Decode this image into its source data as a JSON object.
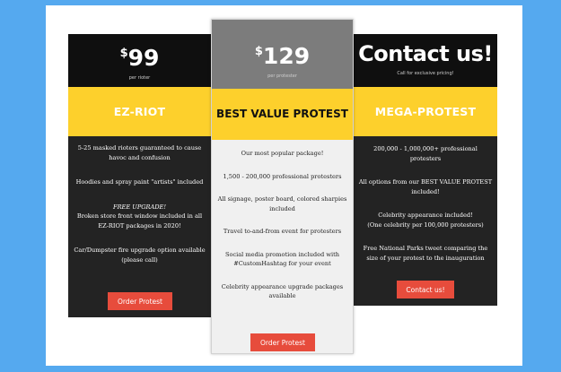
{
  "plans": [
    {
      "price_symbol": "$",
      "price_value": "99",
      "subtitle": "per rioter",
      "name": "EZ-RIOT",
      "features": [
        "5-25 masked rioters guaranteed to cause havoc and confusion",
        "Hoodies and spray paint \"artists\" included",
        "FREE UPGRADE!",
        "Broken store front window included in all EZ-RIOT packages in 2020!",
        "Car/Dumpster fire upgrade option available (please call)"
      ],
      "button_label": "Order Protest"
    },
    {
      "price_symbol": "$",
      "price_value": "129",
      "subtitle": "per protester",
      "name": "BEST VALUE PROTEST",
      "features": [
        "Our most popular package!",
        "1,500 - 200,000 professional protesters",
        "All signage, poster board, colored sharpies included",
        "Travel to-and-from event for protesters",
        "Social media promotion included with #CustomHashtag for your event",
        "Celebrity appearance upgrade packages available"
      ],
      "button_label": "Order Protest"
    },
    {
      "price_text": "Contact us!",
      "subtitle": "Call for exclusive pricing!",
      "name": "MEGA-PROTEST",
      "features": [
        "200,000 - 1,000,000+ professional protesters",
        "All options from our BEST VALUE PROTEST included!",
        "Celebrity appearance included!",
        "(One celebrity per 100,000 protesters)",
        "Free National Parks tweet comparing the size of your protest to the inauguration"
      ],
      "button_label": "Contact us!"
    }
  ],
  "colors": {
    "page_background": "#55a9ef",
    "accent_band": "#fdd02c",
    "button": "#e74c3c",
    "card_dark": "#232323",
    "card_featured": "#f0f0f0",
    "featured_header": "#7c7c7c"
  }
}
